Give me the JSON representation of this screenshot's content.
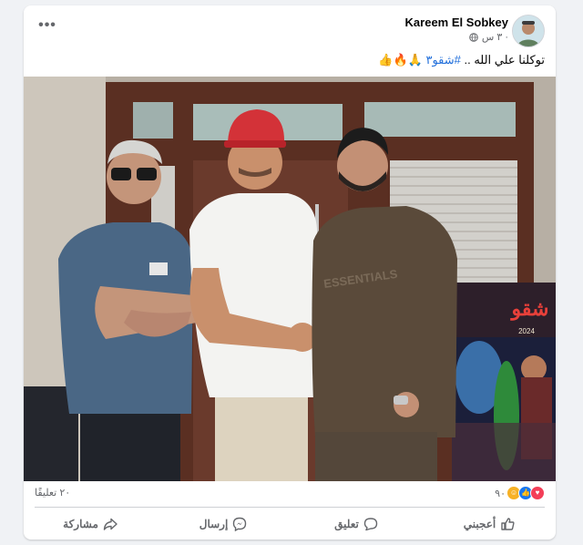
{
  "post": {
    "author": "Kareem El Sobkey",
    "time": "٣ س ·",
    "caption_prefix": "توكلنا علي الله .. ",
    "caption_hashtag": "#شقو٣",
    "caption_emojis": "🙏🔥👍",
    "photo_poster_title": "شقو",
    "photo_poster_year": "2024",
    "photo_shirt_text": "ESSENTIALS"
  },
  "stats": {
    "reactions_count": "٩٠",
    "comments_count": "٢٠ تعليقًا"
  },
  "actions": {
    "like": "أعجبني",
    "comment": "تعليق",
    "send": "إرسال",
    "share": "مشاركة"
  },
  "colors": {
    "like_blue": "#1877f2",
    "love_red": "#f33e58",
    "care_yellow": "#f7b125",
    "hashtag": "#216fdb"
  }
}
